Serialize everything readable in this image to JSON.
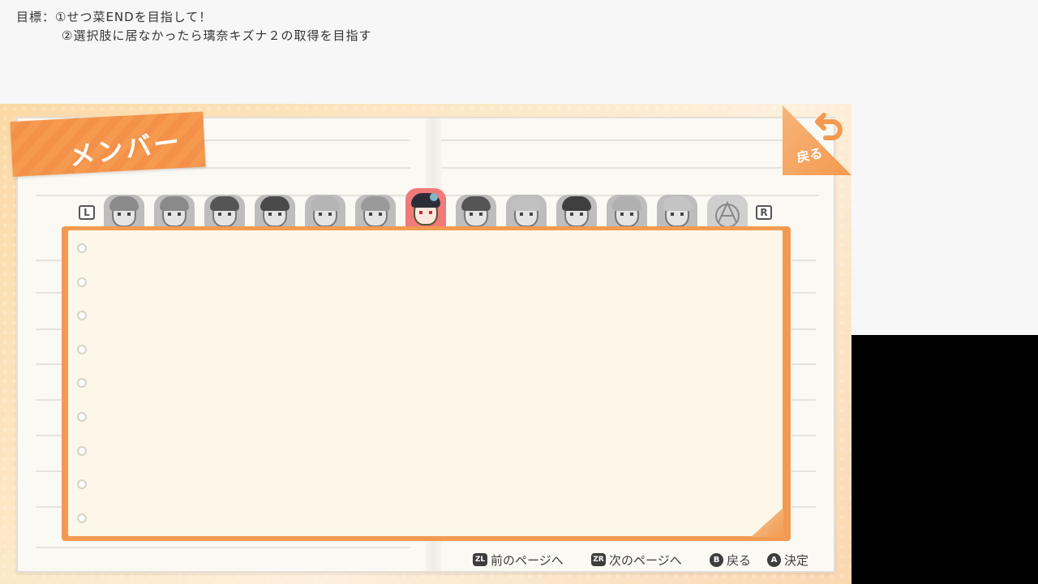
{
  "overlay": {
    "goal_line_1": "目標：①せつ菜ENDを目指して！",
    "goal_line_2": "②選択肢に居なかったら璃奈キズナ２の取得を目指す"
  },
  "screen": {
    "title": "メンバー",
    "back_label": "戻る",
    "left_bumper": "L",
    "right_bumper": "R"
  },
  "members": [
    {
      "icon": "member-portrait-icon",
      "selected": false
    },
    {
      "icon": "member-portrait-icon",
      "selected": false
    },
    {
      "icon": "member-portrait-icon",
      "selected": false
    },
    {
      "icon": "member-portrait-icon",
      "selected": false
    },
    {
      "icon": "member-portrait-icon",
      "selected": false
    },
    {
      "icon": "member-portrait-icon",
      "selected": false
    },
    {
      "icon": "member-portrait-icon",
      "selected": true
    },
    {
      "icon": "member-portrait-icon",
      "selected": false
    },
    {
      "icon": "member-portrait-icon",
      "selected": false
    },
    {
      "icon": "member-portrait-icon",
      "selected": false
    },
    {
      "icon": "member-portrait-icon",
      "selected": false
    },
    {
      "icon": "member-portrait-icon",
      "selected": false
    },
    {
      "icon": "member-emblem-icon",
      "selected": false
    }
  ],
  "hints": [
    {
      "key": "ZL",
      "label": "前のページへ"
    },
    {
      "key": "ZR",
      "label": "次のページへ"
    },
    {
      "key": "B",
      "label": "戻る"
    },
    {
      "key": "A",
      "label": "決定"
    }
  ],
  "colors": {
    "accent_orange": "#f29a52",
    "selected_tab": "#f07a7a",
    "panel_bg": "#fdf7e9"
  }
}
